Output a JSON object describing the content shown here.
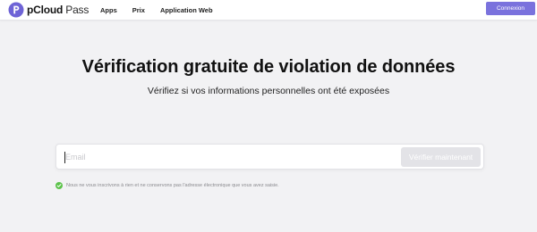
{
  "header": {
    "logo_bold": "pCloud",
    "logo_light": " Pass",
    "nav": [
      "Apps",
      "Prix",
      "Application Web"
    ],
    "login_label": "Connexion"
  },
  "main": {
    "title": "Vérification gratuite de violation de données",
    "subtitle": "Vérifiez si vos informations personnelles ont été exposées",
    "email_placeholder": "Email",
    "email_value": "",
    "verify_label": "Vérifier maintenant",
    "notice": "Nous ne vous inscrivons à rien et ne conservons pas l'adresse électronique que vous avez saisie."
  },
  "icons": {
    "logo": "pcloud-pass-logo-icon",
    "notice": "check-circle-icon"
  },
  "colors": {
    "brand_purple": "#7a72dd",
    "logo_purple": "#6e63d6",
    "check_green": "#5cc24a",
    "background": "#f2f2f4",
    "button_disabled": "#e3e3e7"
  }
}
